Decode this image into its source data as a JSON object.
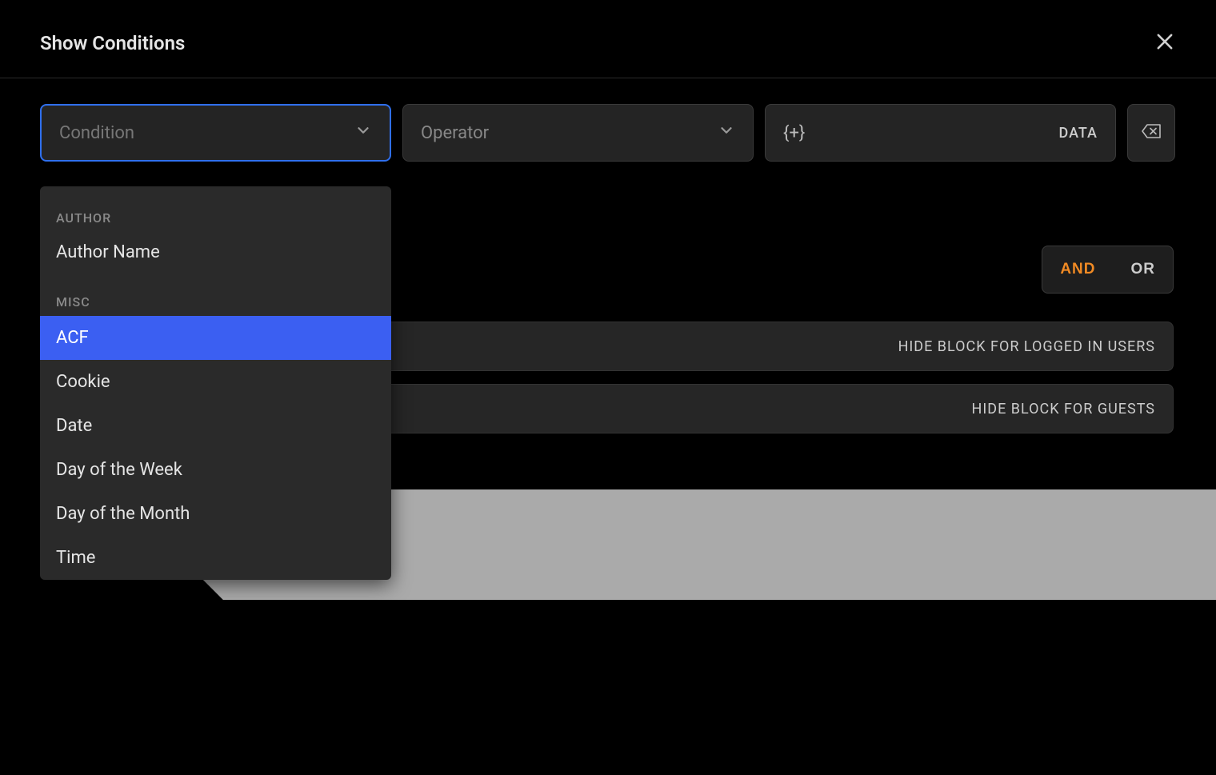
{
  "header": {
    "title": "Show Conditions"
  },
  "fields": {
    "condition_placeholder": "Condition",
    "operator_placeholder": "Operator",
    "data_placeholder": "{+}",
    "data_label": "DATA"
  },
  "logic": {
    "and": "AND",
    "or": "OR"
  },
  "rows": {
    "logged_in": "HIDE BLOCK FOR LOGGED IN USERS",
    "guests": "HIDE BLOCK FOR GUESTS"
  },
  "dropdown": {
    "groups": [
      {
        "label": "AUTHOR",
        "options": [
          "Author Name"
        ]
      },
      {
        "label": "MISC",
        "options": [
          "ACF",
          "Cookie",
          "Date",
          "Day of the Week",
          "Day of the Month",
          "Time"
        ]
      }
    ],
    "highlighted": "ACF"
  }
}
